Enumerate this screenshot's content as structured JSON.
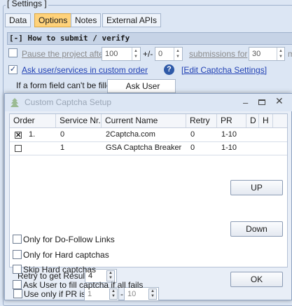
{
  "settings": {
    "caption": "[ Settings ]",
    "tabs": [
      "Data",
      "Options",
      "Notes",
      "External APIs"
    ],
    "active_tab": "Options",
    "section_title": "[-] How to submit / verify",
    "pause_project": {
      "label": "Pause the project after",
      "value": "100",
      "plus_minus": "+/-",
      "variance": "0",
      "submissions_label": "submissions for",
      "minutes": "30",
      "trailing": "m"
    },
    "ask_user_services": {
      "label": "Ask user/services in custom order",
      "checked": true,
      "edit_link": "[Edit Captcha Settings]"
    },
    "form_field": {
      "label": "If a form field can't be filled",
      "value": "Ask User"
    }
  },
  "dialog": {
    "title": "Custom Captcha Setup",
    "columns": [
      "Order",
      "Service Nr.",
      "Current Name",
      "Retry",
      "PR",
      "D",
      "H"
    ],
    "rows": [
      {
        "checked": true,
        "order": "1.",
        "service_nr": "0",
        "name": "2Captcha.com",
        "retry": "0",
        "pr": "1-10"
      },
      {
        "checked": false,
        "order": "",
        "service_nr": "1",
        "name": "GSA Captcha Breaker",
        "retry": "0",
        "pr": "1-10"
      }
    ],
    "retry_label": "Retry to get Result",
    "retry_value": "4",
    "pr_only_label": "Use only if PR is",
    "pr_from": "1",
    "pr_dash": "-",
    "pr_to": "10",
    "dofollow_label": "Only for Do-Follow Links",
    "hard_label": "Only for Hard captchas",
    "skip_hard_label": "Skip Hard captchas",
    "ask_user_label": "Ask User to fill captcha if all fails",
    "up_button": "UP",
    "down_button": "Down",
    "ok_button": "OK"
  },
  "icons": {
    "dialog": "captcha-setup-icon",
    "help": "help-icon",
    "minimize": "minimize-icon",
    "maximize": "maximize-icon",
    "close": "close-icon"
  },
  "colors": {
    "active_tab": "#ffd27a",
    "link": "#1f3fb3",
    "background": "#dce6f4"
  }
}
